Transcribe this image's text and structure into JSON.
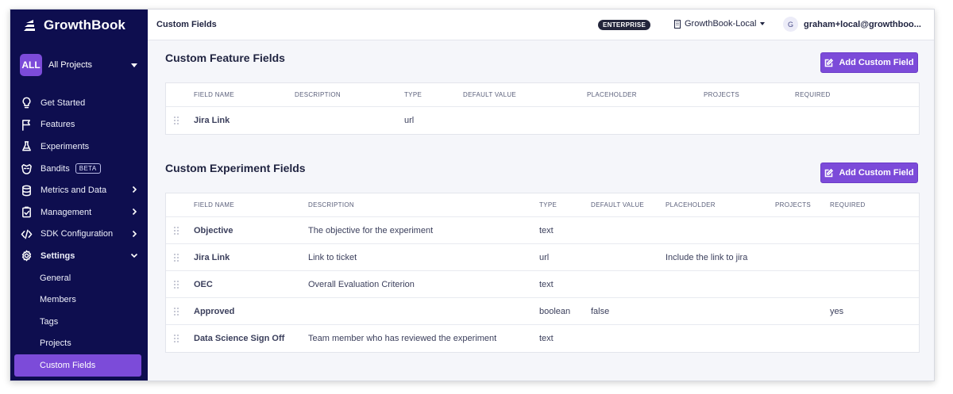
{
  "app": {
    "brand": "GrowthBook"
  },
  "project_selector": {
    "badge": "ALL",
    "label": "All Projects"
  },
  "sidebar": {
    "items": [
      {
        "label": "Get Started",
        "icon": "lightbulb-icon"
      },
      {
        "label": "Features",
        "icon": "flag-icon"
      },
      {
        "label": "Experiments",
        "icon": "flask-icon"
      },
      {
        "label": "Bandits",
        "icon": "bandit-icon",
        "badge": "BETA"
      },
      {
        "label": "Metrics and Data",
        "icon": "database-icon",
        "chevron": "right"
      },
      {
        "label": "Management",
        "icon": "clipboard-icon",
        "chevron": "right"
      },
      {
        "label": "SDK Configuration",
        "icon": "code-icon",
        "chevron": "right"
      },
      {
        "label": "Settings",
        "icon": "gear-icon",
        "chevron": "down"
      }
    ],
    "settings_sub": [
      "General",
      "Members",
      "Tags",
      "Projects",
      "Custom Fields"
    ],
    "active": "Custom Fields"
  },
  "topbar": {
    "title": "Custom Fields",
    "plan_badge": "ENTERPRISE",
    "org": "GrowthBook-Local",
    "user_initial": "G",
    "user_email": "graham+local@growthboo..."
  },
  "feature_fields": {
    "title": "Custom Feature Fields",
    "button": "Add Custom Field",
    "columns": [
      "FIELD NAME",
      "DESCRIPTION",
      "TYPE",
      "DEFAULT VALUE",
      "PLACEHOLDER",
      "PROJECTS",
      "REQUIRED"
    ],
    "rows": [
      [
        "Jira Link",
        "",
        "url",
        "",
        "",
        "",
        ""
      ]
    ]
  },
  "experiment_fields": {
    "title": "Custom Experiment Fields",
    "button": "Add Custom Field",
    "columns": [
      "FIELD NAME",
      "DESCRIPTION",
      "TYPE",
      "DEFAULT VALUE",
      "PLACEHOLDER",
      "PROJECTS",
      "REQUIRED"
    ],
    "rows": [
      [
        "Objective",
        "The objective for the experiment",
        "text",
        "",
        "",
        "",
        ""
      ],
      [
        "Jira Link",
        "Link to ticket",
        "url",
        "",
        "Include the link to jira",
        "",
        ""
      ],
      [
        "OEC",
        "Overall Evaluation Criterion",
        "text",
        "",
        "",
        "",
        ""
      ],
      [
        "Approved",
        "",
        "boolean",
        "false",
        "",
        "",
        "yes"
      ],
      [
        "Data Science Sign Off",
        "Team member who has reviewed the experiment",
        "text",
        "",
        "",
        "",
        ""
      ]
    ]
  },
  "colors": {
    "sidebar_bg": "#0e0e4f",
    "accent": "#7c4bd9"
  }
}
